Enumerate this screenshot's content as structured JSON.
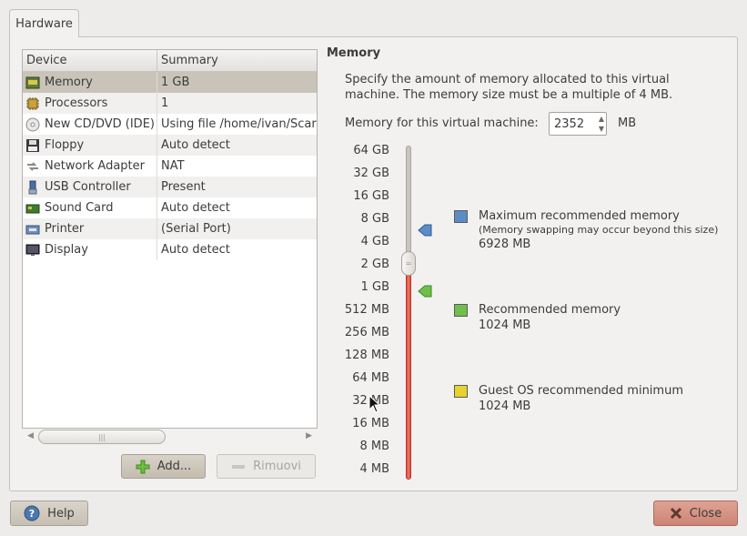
{
  "tabs": [
    {
      "label": "Hardware"
    }
  ],
  "device_list": {
    "columns": [
      "Device",
      "Summary"
    ],
    "rows": [
      {
        "device": "Memory",
        "summary": "1 GB",
        "icon": "memory-icon"
      },
      {
        "device": "Processors",
        "summary": "1",
        "icon": "processor-icon"
      },
      {
        "device": "New CD/DVD (IDE)",
        "summary": "Using file /home/ivan/Scar",
        "icon": "cdrom-icon"
      },
      {
        "device": "Floppy",
        "summary": "Auto detect",
        "icon": "floppy-icon"
      },
      {
        "device": "Network Adapter",
        "summary": "NAT",
        "icon": "network-icon"
      },
      {
        "device": "USB Controller",
        "summary": "Present",
        "icon": "usb-icon"
      },
      {
        "device": "Sound Card",
        "summary": "Auto detect",
        "icon": "soundcard-icon"
      },
      {
        "device": "Printer",
        "summary": "(Serial Port)",
        "icon": "printer-icon"
      },
      {
        "device": "Display",
        "summary": "Auto detect",
        "icon": "display-icon"
      }
    ],
    "selected_index": 0
  },
  "buttons": {
    "add": "Add...",
    "remove": "Rimuovi",
    "help": "Help",
    "close": "Close"
  },
  "memory": {
    "title": "Memory",
    "description": "Specify the amount of memory allocated to this virtual machine. The memory size must be a multiple of 4 MB.",
    "field_label": "Memory for this virtual machine:",
    "value": "2352",
    "unit": "MB",
    "scale_labels": [
      "64 GB",
      "32 GB",
      "16 GB",
      "8 GB",
      "4 GB",
      "2 GB",
      "1 GB",
      "512 MB",
      "256 MB",
      "128 MB",
      "64 MB",
      "32 MB",
      "16 MB",
      "8 MB",
      "4 MB"
    ],
    "legend": {
      "max": {
        "title": "Maximum recommended memory",
        "note": "(Memory swapping may occur beyond this size)",
        "value": "6928 MB",
        "color": "#5b8cc8"
      },
      "recommended": {
        "title": "Recommended memory",
        "value": "1024 MB",
        "color": "#6fbf4a"
      },
      "minimum": {
        "title": "Guest OS recommended minimum",
        "value": "1024 MB",
        "color": "#e8d22c"
      }
    }
  },
  "colors": {
    "slider_fill": "#e05a4a",
    "selection": "#cac3b9",
    "close_button": "#d4917f"
  }
}
